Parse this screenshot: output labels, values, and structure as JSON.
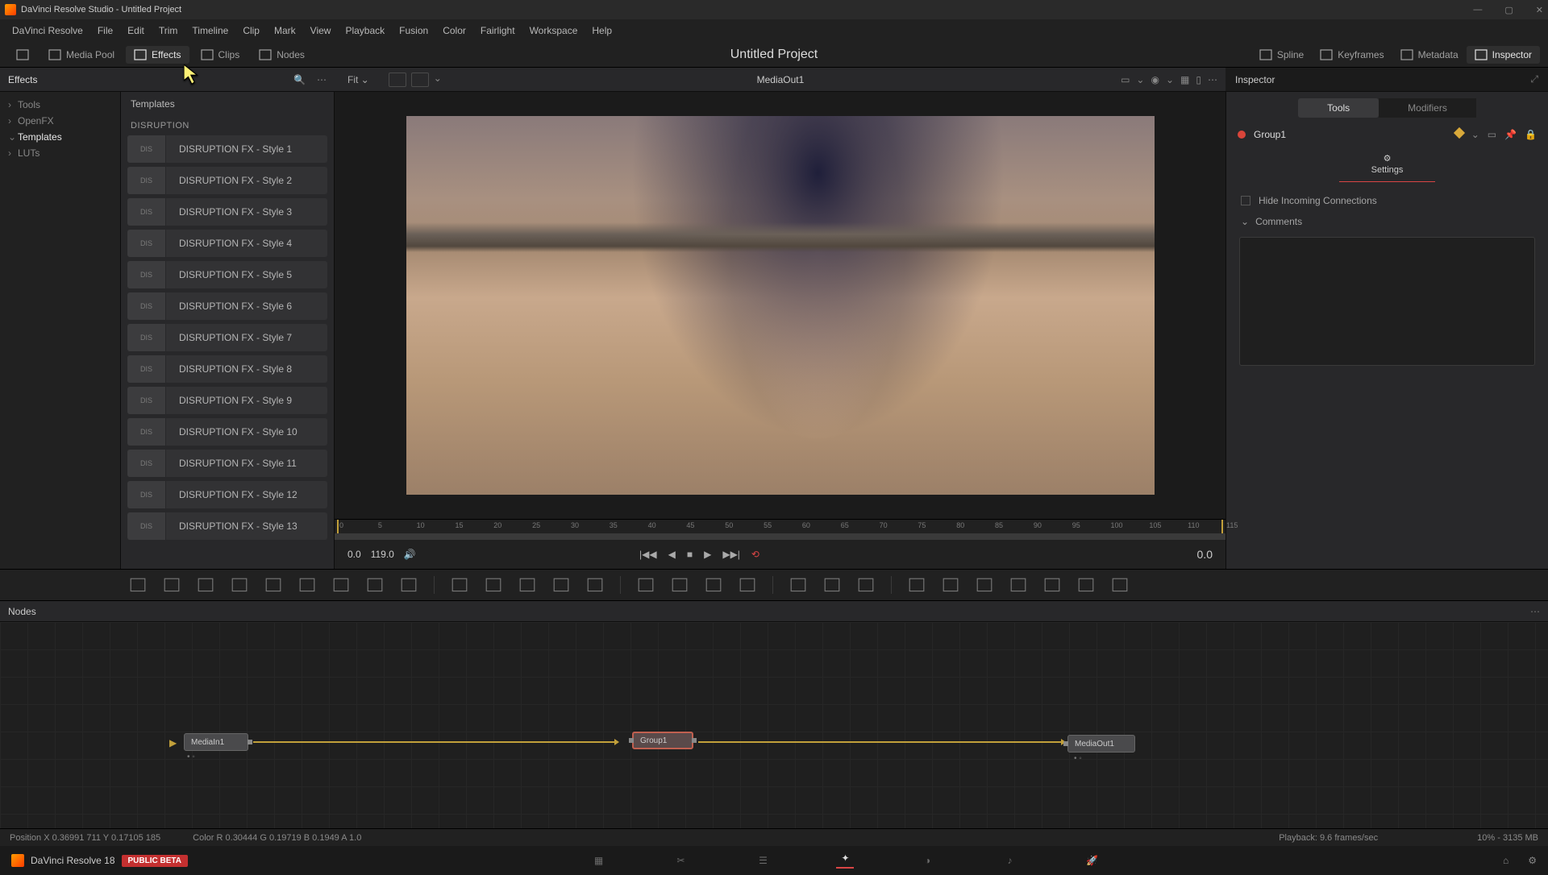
{
  "titlebar": {
    "text": "DaVinci Resolve Studio - Untitled Project"
  },
  "menubar": [
    "DaVinci Resolve",
    "File",
    "Edit",
    "Trim",
    "Timeline",
    "Clip",
    "Mark",
    "View",
    "Playback",
    "Fusion",
    "Color",
    "Fairlight",
    "Workspace",
    "Help"
  ],
  "toptoolbar": {
    "left": [
      {
        "label": "",
        "icon": "dropdown-icon"
      },
      {
        "label": "Media Pool",
        "icon": "media-pool-icon"
      },
      {
        "label": "Effects",
        "icon": "effects-icon",
        "active": true
      },
      {
        "label": "Clips",
        "icon": "clips-icon"
      },
      {
        "label": "Nodes",
        "icon": "nodes-icon"
      }
    ],
    "title": "Untitled Project",
    "right": [
      {
        "label": "Spline",
        "icon": "spline-icon"
      },
      {
        "label": "Keyframes",
        "icon": "keyframes-icon"
      },
      {
        "label": "Metadata",
        "icon": "metadata-icon"
      },
      {
        "label": "Inspector",
        "icon": "inspector-icon",
        "active": true
      }
    ]
  },
  "effects": {
    "header": "Effects",
    "tree": [
      {
        "label": "Tools",
        "children": true
      },
      {
        "label": "OpenFX",
        "children": true
      },
      {
        "label": "Templates",
        "children": true,
        "expanded": true,
        "selected": true
      },
      {
        "label": "LUTs",
        "children": true
      }
    ],
    "tab": "Templates",
    "category": "DISRUPTION",
    "thumb_tag": "DIS",
    "items": [
      "DISRUPTION FX - Style 1",
      "DISRUPTION FX - Style 2",
      "DISRUPTION FX - Style 3",
      "DISRUPTION FX - Style 4",
      "DISRUPTION FX - Style 5",
      "DISRUPTION FX - Style 6",
      "DISRUPTION FX - Style 7",
      "DISRUPTION FX - Style 8",
      "DISRUPTION FX - Style 9",
      "DISRUPTION FX - Style 10",
      "DISRUPTION FX - Style 11",
      "DISRUPTION FX - Style 12",
      "DISRUPTION FX - Style 13"
    ]
  },
  "viewer": {
    "fit": "Fit ⌄",
    "label": "MediaOut1",
    "ticks": [
      "0",
      "5",
      "10",
      "15",
      "20",
      "25",
      "30",
      "35",
      "40",
      "45",
      "50",
      "55",
      "60",
      "65",
      "70",
      "75",
      "80",
      "85",
      "90",
      "95",
      "100",
      "105",
      "110",
      "115"
    ],
    "in": "0.0",
    "out": "119.0",
    "time": "0.0"
  },
  "inspector": {
    "header": "Inspector",
    "tabs": {
      "tools": "Tools",
      "modifiers": "Modifiers"
    },
    "node": "Group1",
    "settings": "Settings",
    "hide_incoming": "Hide Incoming Connections",
    "comments": "Comments"
  },
  "nodes_panel": {
    "header": "Nodes",
    "n1": "MediaIn1",
    "n2": "Group1",
    "n3": "MediaOut1"
  },
  "status": {
    "pos": "Position   X 0.36991    711    Y 0.17105    185",
    "color": "Color R 0.30444    G 0.19719    B 0.1949    A 1.0",
    "playback": "Playback: 9.6 frames/sec",
    "mem": "10% - 3135 MB"
  },
  "pageswitch": {
    "app": "DaVinci Resolve 18",
    "beta": "PUBLIC BETA"
  }
}
